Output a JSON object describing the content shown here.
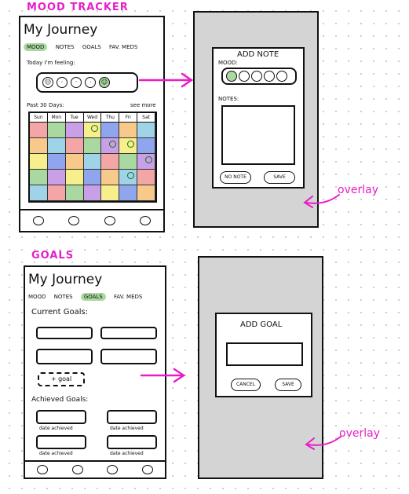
{
  "sections": {
    "mood_tracker_title": "MOOD TRACKER",
    "goals_title": "GOALS"
  },
  "app": {
    "title": "My Journey",
    "tabs": [
      "MOOD",
      "NOTES",
      "GOALS",
      "FAV. MEDS"
    ]
  },
  "mood_screen": {
    "prompt": "Today I'm feeling:",
    "past_label": "Past 30 Days:",
    "see_more": "see more",
    "days": [
      "Sun",
      "Mon",
      "Tue",
      "Wed",
      "Thu",
      "Fri",
      "Sat"
    ]
  },
  "note_overlay": {
    "title": "ADD NOTE",
    "mood_label": "MOOD:",
    "notes_label": "NOTES:",
    "no_note_button": "NO NOTE",
    "save_button": "SAVE",
    "overlay_label": "overlay"
  },
  "goals_screen": {
    "current_label": "Current Goals:",
    "add_goal": "+ goal",
    "achieved_label": "Achieved Goals:",
    "date_achieved": "date achieved"
  },
  "goal_overlay": {
    "title": "ADD GOAL",
    "cancel_button": "CANCEL",
    "save_button": "SAVE",
    "overlay_label": "overlay"
  },
  "colors": {
    "accent": "#e81ec8",
    "highlight": "#a9d9a0",
    "overlay_grey": "#d4d4d4"
  }
}
